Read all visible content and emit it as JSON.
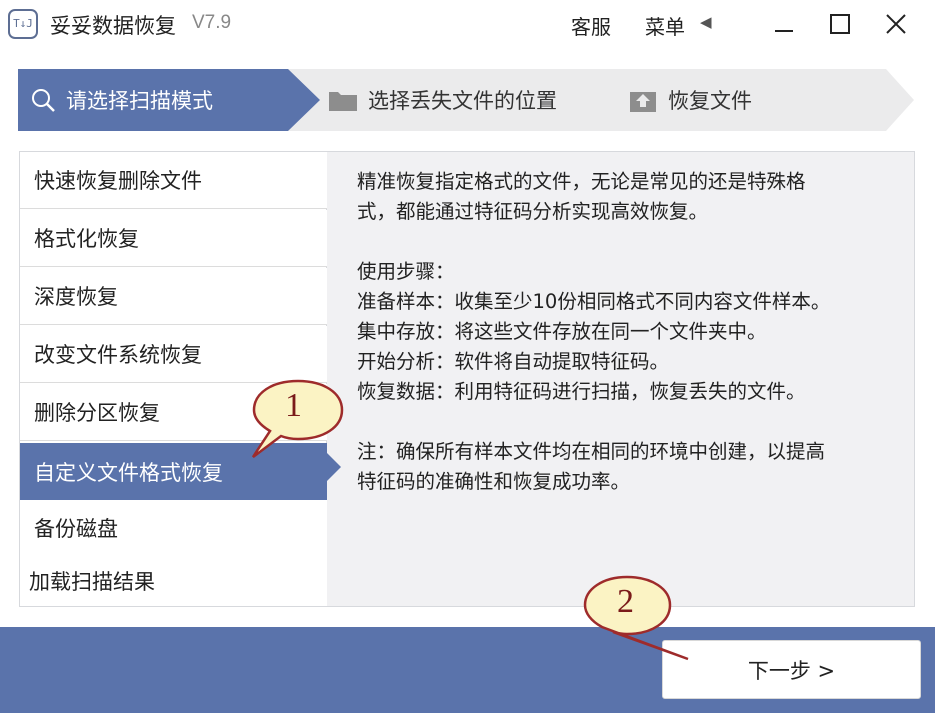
{
  "window": {
    "logo_text": "T↓J",
    "title": "妥妥数据恢复",
    "version": "V7.9",
    "service_label": "客服",
    "menu_label": "菜单",
    "menu_arrow": "◀"
  },
  "steps": [
    {
      "label": "请选择扫描模式",
      "icon": "search-icon",
      "active": true
    },
    {
      "label": "选择丢失文件的位置",
      "icon": "folder-icon",
      "active": false
    },
    {
      "label": "恢复文件",
      "icon": "upload-icon",
      "active": false
    }
  ],
  "modes": [
    {
      "label": "快速恢复删除文件"
    },
    {
      "label": "格式化恢复"
    },
    {
      "label": "深度恢复"
    },
    {
      "label": "改变文件系统恢复"
    },
    {
      "label": "删除分区恢复"
    },
    {
      "label": "自定义文件格式恢复",
      "active": true
    },
    {
      "label": "备份磁盘"
    },
    {
      "label": "加载扫描结果"
    }
  ],
  "description": {
    "intro_line1": "精准恢复指定格式的文件，无论是常见的还是特殊格",
    "intro_line2": "式，都能通过特征码分析实现高效恢复。",
    "steps_heading": "使用步骤：",
    "step_prepare": "准备样本：收集至少10份相同格式不同内容文件样本。",
    "step_store": "集中存放：将这些文件存放在同一个文件夹中。",
    "step_analyze": "开始分析：软件将自动提取特征码。",
    "step_recover": "恢复数据：利用特征码进行扫描，恢复丢失的文件。",
    "note_line1": "注：确保所有样本文件均在相同的环境中创建，以提高",
    "note_line2": "特征码的准确性和恢复成功率。"
  },
  "next_button": {
    "label": "下一步 >"
  },
  "callouts": [
    {
      "number": "1"
    },
    {
      "number": "2"
    }
  ],
  "colors": {
    "accent": "#5a73ab",
    "panel_bg": "#f1f1f3",
    "callout_fill": "#fbf3c4",
    "callout_stroke": "#9e2b2b"
  }
}
